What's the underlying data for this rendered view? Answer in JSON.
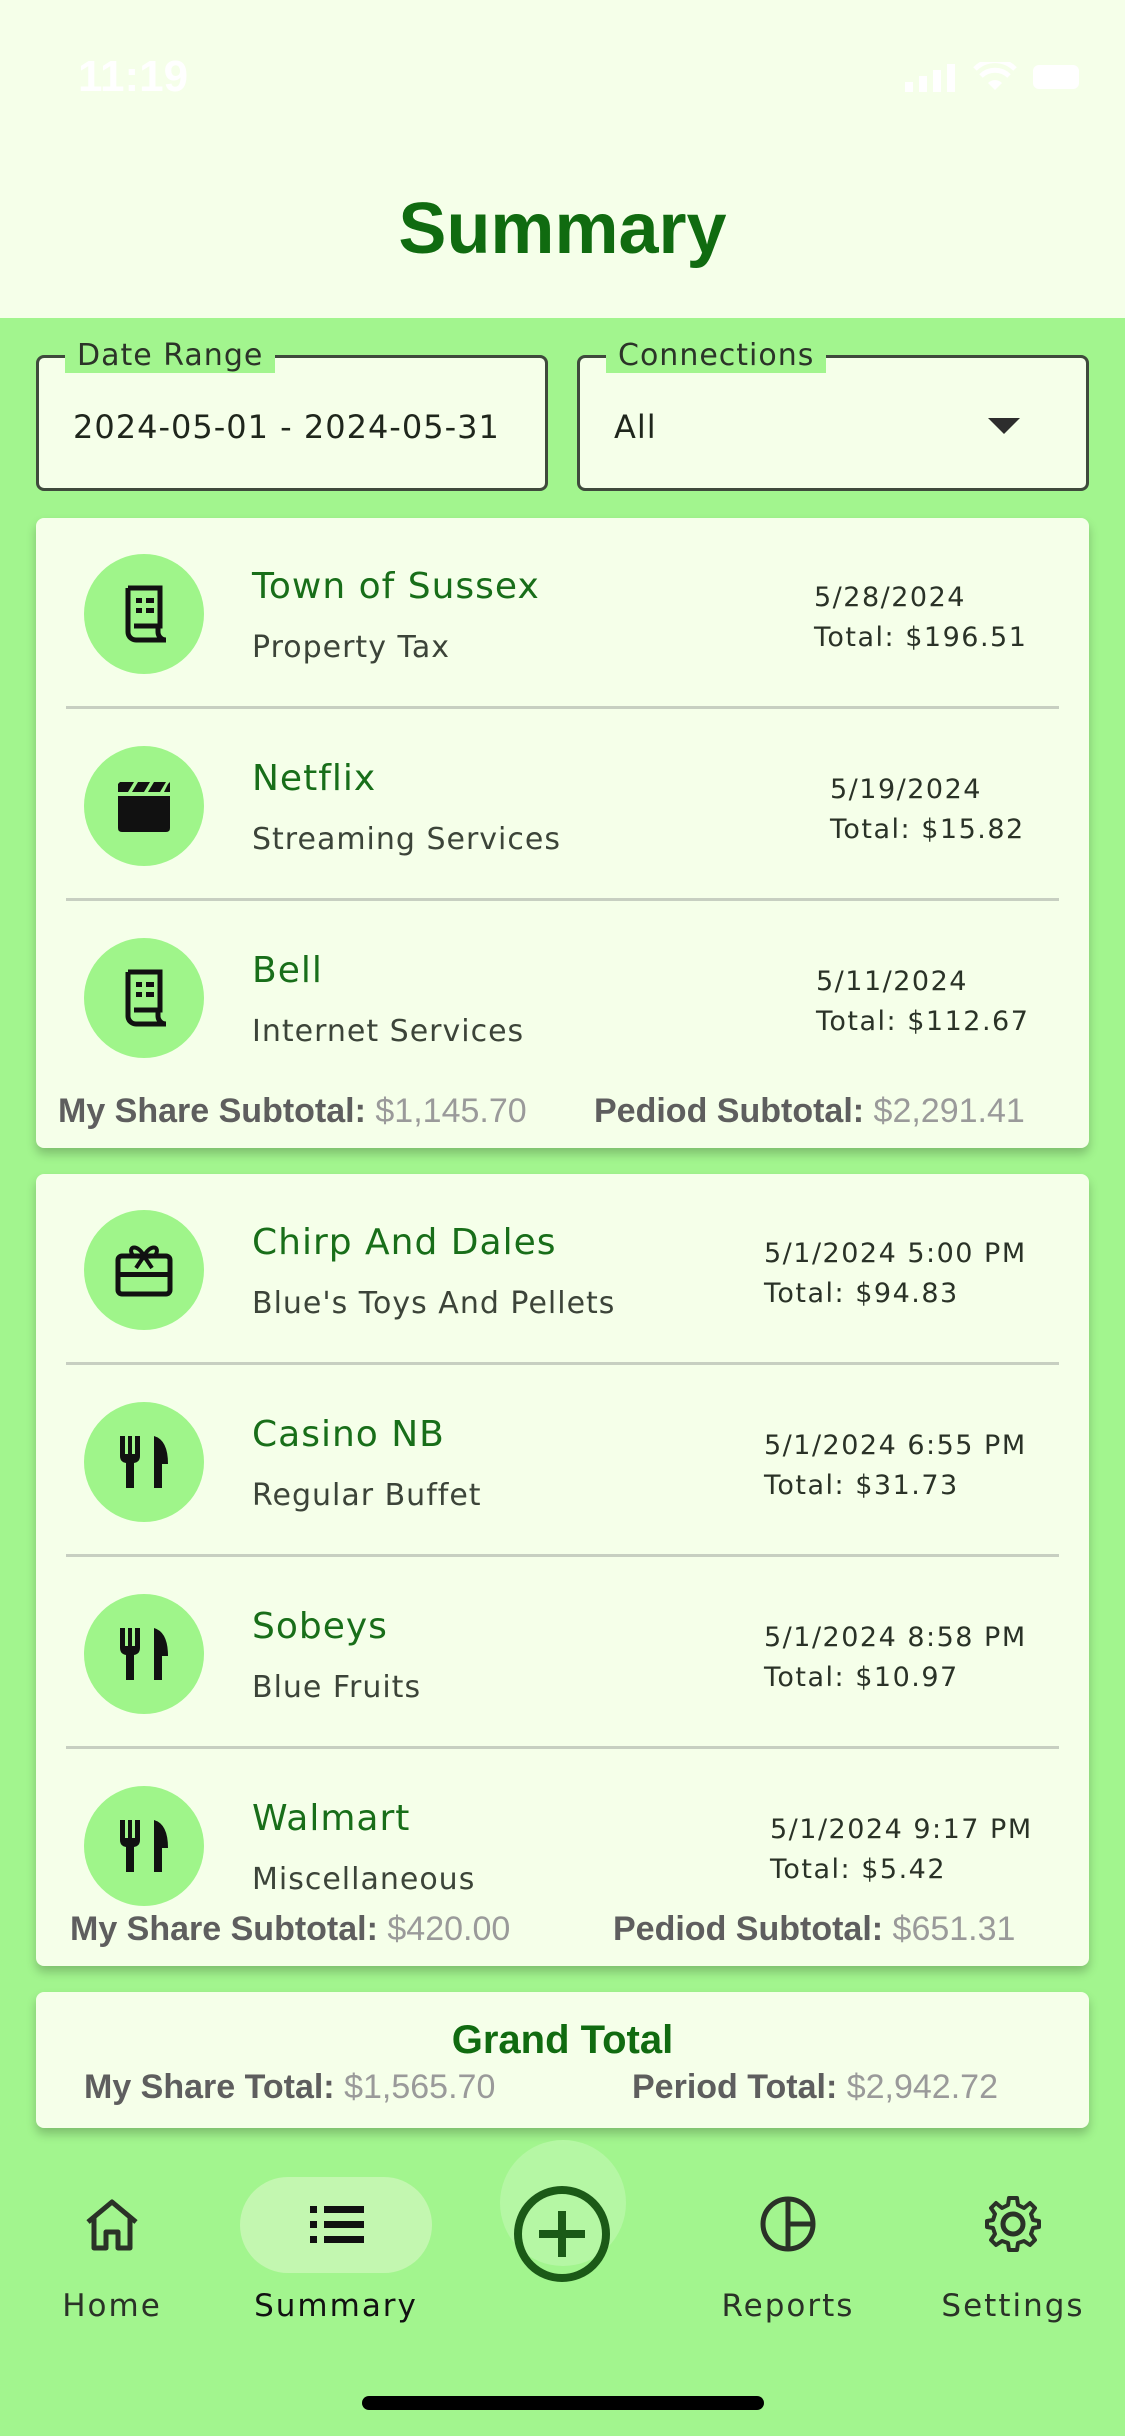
{
  "status_bar": {
    "time": "11:19"
  },
  "header": {
    "title": "Summary"
  },
  "filters": {
    "date_range": {
      "label": "Date Range",
      "value": "2024-05-01 - 2024-05-31"
    },
    "connections": {
      "label": "Connections",
      "value": "All"
    }
  },
  "groups": [
    {
      "items": [
        {
          "merchant": "Town of Sussex",
          "category": "Property Tax",
          "date": "5/28/2024",
          "total": "Total: $196.51",
          "icon": "receipt-icon"
        },
        {
          "merchant": "Netflix",
          "category": "Streaming Services",
          "date": "5/19/2024",
          "total": "Total: $15.82",
          "icon": "clapperboard-icon"
        },
        {
          "merchant": "Bell",
          "category": "Internet Services",
          "date": "5/11/2024",
          "total": "Total: $112.67",
          "icon": "receipt-icon"
        }
      ],
      "my_share_label": "My Share Subtotal:",
      "my_share_value": "$1,145.70",
      "period_label": "Pediod Subtotal:",
      "period_value": "$2,291.41"
    },
    {
      "items": [
        {
          "merchant": "Chirp And Dales",
          "category": "Blue's Toys And Pellets",
          "date": "5/1/2024 5:00 PM",
          "total": "Total: $94.83",
          "icon": "gift-card-icon"
        },
        {
          "merchant": "Casino NB",
          "category": "Regular Buffet",
          "date": "5/1/2024 6:55 PM",
          "total": "Total: $31.73",
          "icon": "fork-knife-icon"
        },
        {
          "merchant": "Sobeys",
          "category": "Blue Fruits",
          "date": "5/1/2024 8:58 PM",
          "total": "Total: $10.97",
          "icon": "fork-knife-icon"
        },
        {
          "merchant": "Walmart",
          "category": "Miscellaneous",
          "date": "5/1/2024 9:17 PM",
          "total": "Total: $5.42",
          "icon": "fork-knife-icon"
        }
      ],
      "my_share_label": "My Share Subtotal:",
      "my_share_value": "$420.00",
      "period_label": "Pediod Subtotal:",
      "period_value": "$651.31"
    }
  ],
  "grand_total": {
    "title": "Grand Total",
    "my_share_label": "My Share Total:",
    "my_share_value": "$1,565.70",
    "period_label": "Period Total:",
    "period_value": "$2,942.72"
  },
  "nav": {
    "home": "Home",
    "summary": "Summary",
    "reports": "Reports",
    "settings": "Settings",
    "selected": "summary"
  },
  "colors": {
    "background": "#a2f58e",
    "header": "#f5ffe9",
    "accent": "#106b10",
    "icon_circle": "#9ff58a"
  }
}
